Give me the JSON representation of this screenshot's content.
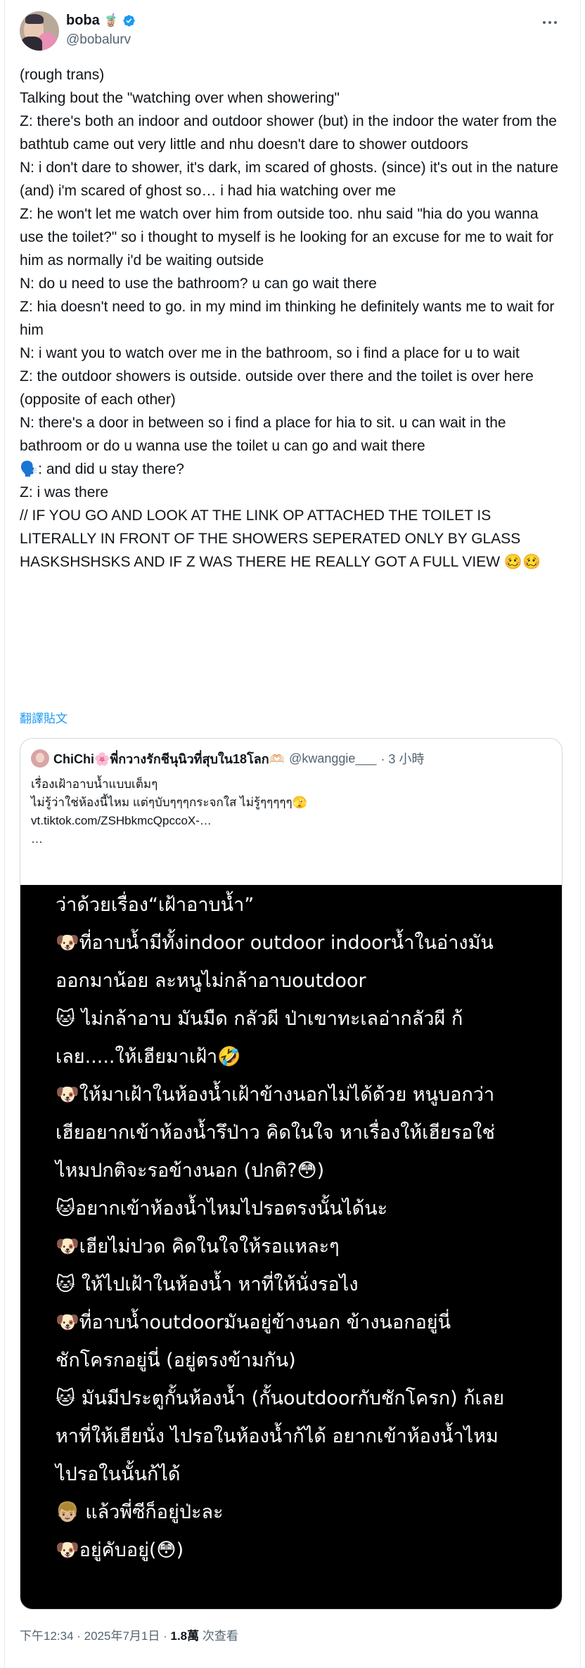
{
  "author": {
    "name": "boba",
    "name_emoji": "🧋",
    "handle": "@bobalurv"
  },
  "tweet": {
    "lines": [
      "(rough trans)",
      "",
      "Talking bout the \"watching over when showering\"",
      "",
      "Z: there's both an indoor and outdoor shower (but) in the indoor the water from the bathtub came out very little and nhu doesn't dare to shower outdoors",
      "N: i don't dare to shower, it's dark, im scared of ghosts. (since) it's out in the nature (and) i'm scared of ghost so… i had hia watching over me",
      "Z: he won't let me watch over him from outside too. nhu said \"hia do you wanna use the toilet?\" so i thought to myself is he looking for an excuse for me to wait for him as normally i'd be waiting outside",
      "N: do u need to use the bathroom? u can go wait there",
      "Z: hia doesn't need to go. in my mind im thinking he definitely wants me to wait for him",
      "N: i want you to watch over me in the bathroom, so i find a place for u to wait",
      "Z: the outdoor showers is outside. outside over there and the toilet is over here (opposite of each other)",
      "N: there's a door in between so i find a place for hia to sit. u can wait in the bathroom or do u wanna use the toilet u can go and wait there",
      "🗣️: and did u stay there?",
      "Z: i was there",
      "",
      "// IF YOU GO AND LOOK AT THE LINK OP ATTACHED THE TOILET IS LITERALLY IN FRONT OF THE SHOWERS SEPERATED ONLY BY GLASS HASKSHSHSKS AND IF Z WAS THERE HE REALLY GOT A FULL VIEW 🥴🥴"
    ],
    "translate_label": "翻譯貼文"
  },
  "quote": {
    "name": "ChiChi🌸พี่กวางรักชีนุนิวที่สุบใน18โลก🫶🏻",
    "handle": "@kwanggie___",
    "time": "· 3 小時",
    "lines": [
      "เรื่องเฝ้าอาบน้ำแบบเต็มๆ",
      "",
      "ไม่รู้ว่าใช่ห้องนี้ไหม แต่ๆบับๆๆๆกระจกใส ไม่รู้ๆๆๆๆๆ🫣",
      "vt.tiktok.com/ZSHbkmcQpccoX-…",
      "…"
    ],
    "media_lines": [
      "ว่าด้วยเรื่อง“เฝ้าอาบน้ำ”",
      "",
      "🐶ที่อาบน้ำมีทั้งindoor outdoor indoorน้ำในอ่างมัน",
      "ออกมาน้อย ละหนูไม่กล้าอาบoutdoor",
      "🐱 ไม่กล้าอาบ มันมืด กลัวผี ป่าเขาทะเลอ่ากลัวผี ก้",
      "เลย.....ให้เฮียมาเฝ้า🤣",
      "🐶ให้มาเฝ้าในห้องน้ำเฝ้าข้างนอกไม่ได้ด้วย หนูบอกว่า",
      "เฮียอยากเข้าห้องน้ำรึป่าว คิดในใจ หาเรื่องให้เฮียรอใช่",
      "ไหมปกติจะรอข้างนอก (ปกติ?😳)",
      "🐱อยากเข้าห้องน้ำไหมไปรอตรงนั้นได้นะ",
      "🐶เฮียไม่ปวด คิดในใจให้รอแหละๆ",
      "🐱 ให้ไปเฝ้าในห้องน้ำ หาที่ให้นั่งรอไง",
      "🐶ที่อาบน้ำoutdoorมันอยู่ข้างนอก ข้างนอกอยู่นี่",
      "ชักโครกอยู่นี่ (อยู่ตรงข้ามกัน)",
      "🐱 มันมีประตูกั้นห้องน้ำ (กั้นoutdoorกับชักโครก) ก้เลย",
      "หาที่ให้เฮียนั่ง ไปรอในห้องน้ำก้ได้ อยากเข้าห้องน้ำไหม",
      "ไปรอในนั้นก้ได้",
      "👦🏼 แล้วพี่ซีก็อยู่ป่ะละ",
      "🐶อยู่คับอยู่(😳)"
    ]
  },
  "footer": {
    "timestamp": "下午12:34 · 2025年7月1日 · ",
    "views": "1.8萬",
    "views_label": " 次查看"
  }
}
